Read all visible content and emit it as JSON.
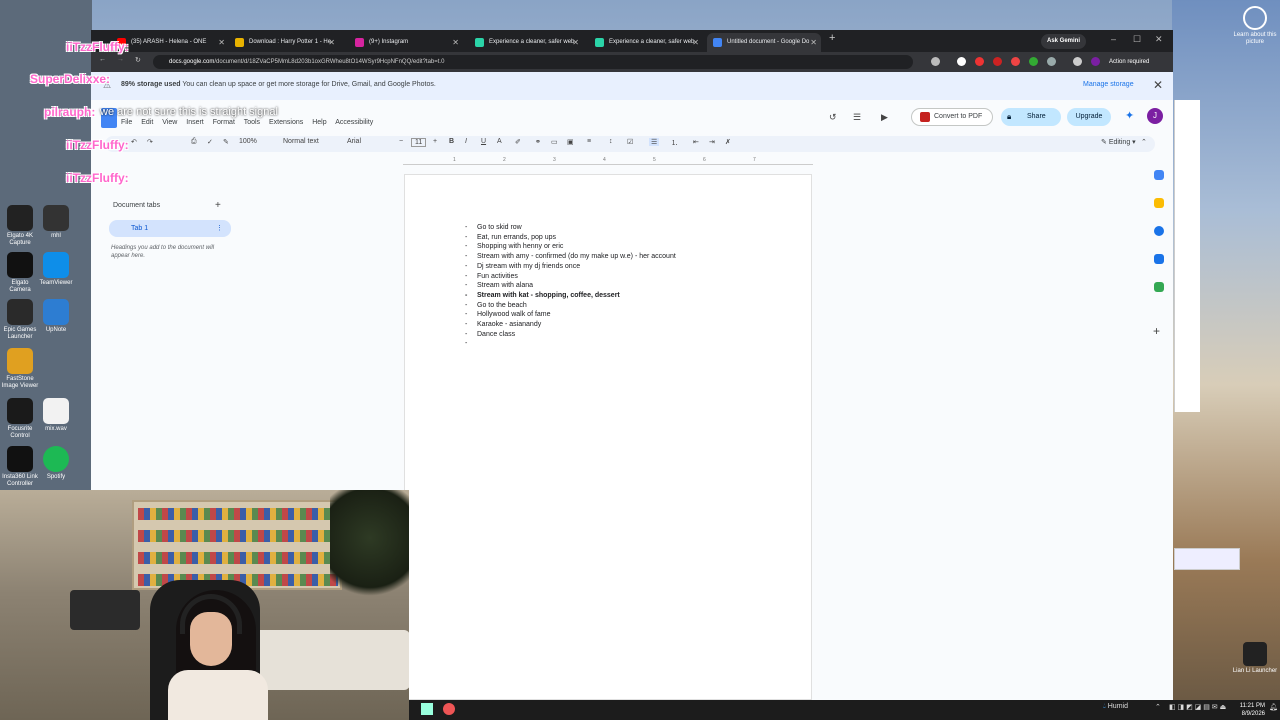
{
  "browser": {
    "tabs": [
      {
        "title": "(35) ARASH - Helena - ONE"
      },
      {
        "title": "Download : Harry Potter 1 - He"
      },
      {
        "title": "(9+) Instagram"
      },
      {
        "title": "Experience a cleaner, safer web"
      },
      {
        "title": "Experience a cleaner, safer web"
      },
      {
        "title": "Untitled document - Google Do"
      }
    ],
    "ask_gemini": "Ask Gemini",
    "url_host": "docs.google.com",
    "url_path": "/document/d/18ZVaCP5MmL8d203b1oxGRWheu8tO14WSyr9HcpNFnQQ/edit?tab=t.0",
    "action_required": "Action required"
  },
  "banner": {
    "text_bold": "89% storage used",
    "text": "You can clean up space or get more storage for Drive, Gmail, and Google Photos.",
    "manage": "Manage storage"
  },
  "docs": {
    "menu": [
      "File",
      "Edit",
      "View",
      "Insert",
      "Format",
      "Tools",
      "Extensions",
      "Help",
      "Accessibility"
    ],
    "convert_pdf": "Convert to PDF",
    "share": "Share",
    "upgrade": "Upgrade",
    "avatar_letter": "J",
    "toolbar": {
      "zoom": "100%",
      "style": "Normal text",
      "font": "Arial",
      "size": "11",
      "mode": "Editing"
    },
    "ruler_marks": [
      "1",
      "2",
      "3",
      "4",
      "5",
      "6",
      "7"
    ],
    "doc_tabs_title": "Document tabs",
    "tab1": "Tab 1",
    "tab_note": "Headings you add to the document will appear here.",
    "list": [
      {
        "text": "Go to skid row",
        "bold": false
      },
      {
        "text": "Eat, run errands, pop ups",
        "bold": false
      },
      {
        "text": "Shopping with henny or eric",
        "bold": false
      },
      {
        "text": "Stream with amy - confirmed (do my make up w.e) - her account",
        "bold": false
      },
      {
        "text": "Dj stream with my dj friends once",
        "bold": false
      },
      {
        "text": "Fun activities",
        "bold": false
      },
      {
        "text": "Stream with alana",
        "bold": false
      },
      {
        "text": "Stream with kat - shopping, coffee, dessert",
        "bold": true
      },
      {
        "text": "Go to the beach",
        "bold": false
      },
      {
        "text": "Hollywood walk of fame",
        "bold": false
      },
      {
        "text": "Karaoke - asianandy",
        "bold": false
      },
      {
        "text": "Dance class",
        "bold": false
      },
      {
        "text": "",
        "bold": false
      }
    ]
  },
  "overlay_chat": {
    "user1": "iiTzzFluffy:",
    "user2": "SuperDelixxe:",
    "user3": "pilrauph:",
    "msg3": "we are not sure this is straight signal",
    "user4": "iiTzzFluffy:",
    "user5": "iiTzzFluffy:"
  },
  "desktop_icons": [
    {
      "label": "Elgato 4K Capture"
    },
    {
      "label": "mhl"
    },
    {
      "label": "Elgato Camera"
    },
    {
      "label": "TeamViewer"
    },
    {
      "label": "Epic Games Launcher"
    },
    {
      "label": "UpNote"
    },
    {
      "label": "FastStone Image Viewer"
    },
    {
      "label": "Focusrite Control"
    },
    {
      "label": "mix.wav"
    },
    {
      "label": "Insta360 Link Controller"
    },
    {
      "label": "Spotify"
    }
  ],
  "right_icons": [
    {
      "label": "Learn about this picture"
    },
    {
      "label": "Lian Li Launcher"
    }
  ],
  "taskbar": {
    "weather": "Humid",
    "time": "11:21 PM",
    "date": "8/9/2026"
  },
  "colors": {
    "accent": "#1a73e8",
    "share_bg": "#c2e7ff",
    "banner_bg": "#e8f0fe",
    "chat_pink": "#ff66cc"
  }
}
